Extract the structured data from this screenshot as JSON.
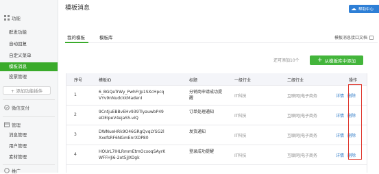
{
  "top_badge": {
    "label": "帮助中心"
  },
  "sidebar": {
    "section_features": "功能",
    "feature_items": [
      "群发功能",
      "自动回复",
      "自定义菜单",
      "模板消息",
      "投票管理"
    ],
    "active_index": 3,
    "add_plugin": "+ 添加功能插件",
    "section_wxpay": "微信支付",
    "section_manage": "管理",
    "manage_items": [
      "消息管理",
      "用户管理",
      "素材管理"
    ],
    "section_more": "推广"
  },
  "main": {
    "title": "模板消息",
    "tabs": [
      "我的模板",
      "模板库"
    ],
    "api_doc": "模板消息接口文档",
    "remain_text": "还可添加10个",
    "add_button": "从模板库中添加"
  },
  "table": {
    "headers": [
      "序号",
      "模板ID",
      "标题",
      "一级行业",
      "二级行业",
      "操作"
    ],
    "rows": [
      {
        "index": "1",
        "id": "6_BGQeTrWy_PwhFrJp1SXcHpcqVYv9nNudckkMadenI",
        "title": "分销商申请成功提醒",
        "industry1": "IT科技",
        "industry2": "互联网|电子商务",
        "detail": "详情",
        "delete": "删除"
      },
      {
        "index": "2",
        "id": "9CntjuEBBvEHv939TlyauwbP49eDEIpeV4ejaS5-viQ",
        "title": "订单处理通知",
        "industry1": "IT科技",
        "industry2": "互联网|电子商务",
        "detail": "详情",
        "delete": "删除"
      },
      {
        "index": "3",
        "id": "DWNueHRk9O46GRgQvqLYSG2lXxofsRF6NGmEnrXOP80",
        "title": "发货通知",
        "industry1": "IT科技",
        "industry2": "互联网|电子商务",
        "detail": "详情",
        "delete": "删除"
      },
      {
        "index": "4",
        "id": "HOUrL7IHLRmmEtmOcxoqSAyrKWFFHJi6-2ot5jJXOgk",
        "title": "登录成功提醒",
        "industry1": "IT科技",
        "industry2": "互联网|电子商务",
        "detail": "详情",
        "delete": "删除"
      }
    ]
  },
  "colors": {
    "accent_green": "#3aab2b",
    "link_blue": "#2f7bc8",
    "highlight_red": "#e0392f"
  }
}
